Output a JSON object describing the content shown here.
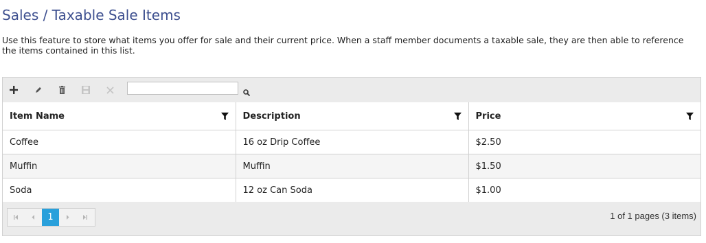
{
  "page": {
    "title": "Sales / Taxable Sale Items",
    "description": "Use this feature to store what items you offer for sale and their current price. When a staff member documents a taxable sale, they are then able to reference the items contained in this list."
  },
  "toolbar": {
    "buttons": [
      "plus-icon",
      "pencil-icon",
      "trash-icon",
      "save-icon",
      "cancel-icon"
    ],
    "search": {
      "value": "",
      "placeholder": ""
    }
  },
  "table": {
    "columns": [
      "Item Name",
      "Description",
      "Price"
    ],
    "rows": [
      [
        "Coffee",
        "16 oz Drip Coffee",
        "$2.50"
      ],
      [
        "Muffin",
        "Muffin",
        "$1.50"
      ],
      [
        "Soda",
        "12 oz Can Soda",
        "$1.00"
      ]
    ]
  },
  "pager": {
    "current_page": "1",
    "info": "1 of 1 pages (3 items)",
    "active_color": "#29a0db"
  }
}
